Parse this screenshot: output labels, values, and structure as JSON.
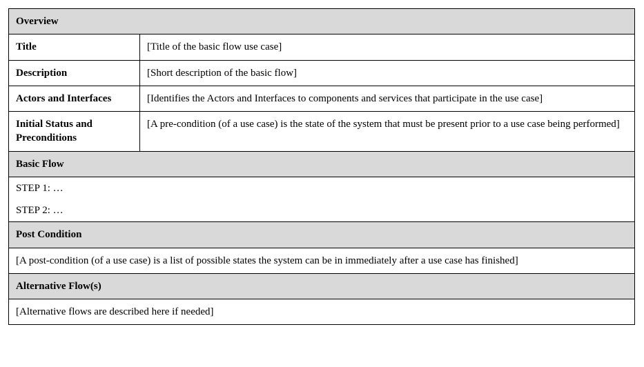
{
  "overview": {
    "header": "Overview",
    "title_label": "Title",
    "title_value": "[Title of the basic flow use case]",
    "description_label": "Description",
    "description_value": "[Short description of the basic flow]",
    "actors_label": "Actors and Interfaces",
    "actors_value": "[Identifies the Actors and Interfaces to components and services that participate in the use case]",
    "initial_label": "Initial Status and Preconditions",
    "initial_value": "[A pre-condition (of a use case) is the state of the system that must be present prior to a use case being performed]"
  },
  "basic_flow": {
    "header": "Basic Flow",
    "step1": "STEP 1: …",
    "step2": "STEP 2: …"
  },
  "post_condition": {
    "header": "Post Condition",
    "content": "[A post-condition (of a use case) is a list of possible states the system can be in immediately after a use case has finished]"
  },
  "alternative_flow": {
    "header": "Alternative Flow(s)",
    "content": "[Alternative flows are described here if needed]"
  }
}
